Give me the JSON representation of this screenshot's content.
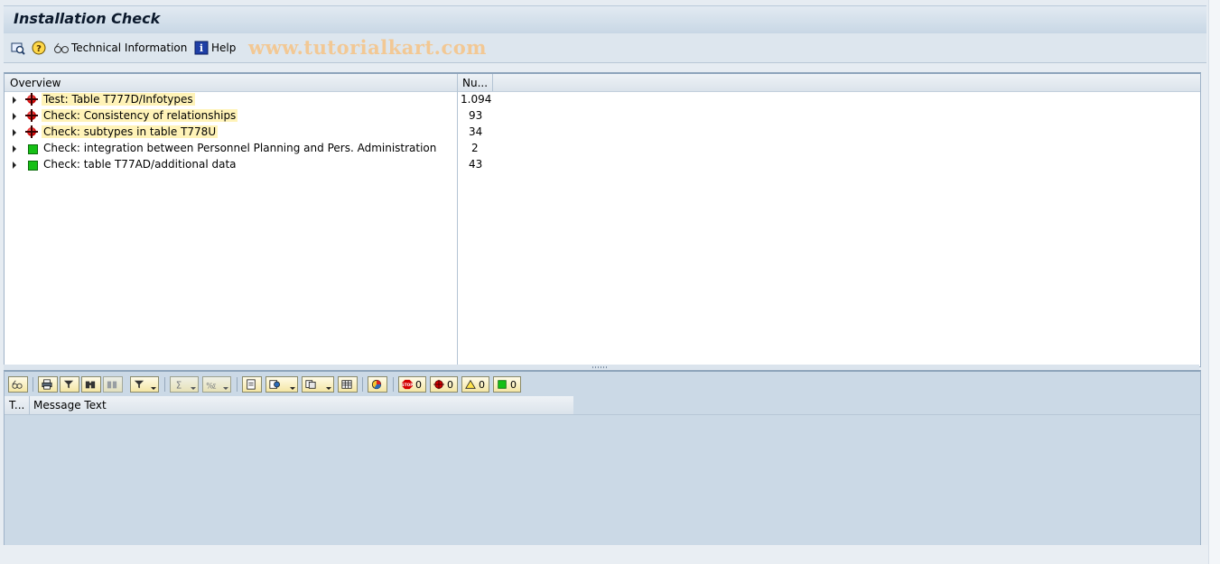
{
  "window": {
    "title": "Installation Check"
  },
  "toolbar": {
    "technical_information": "Technical Information",
    "help": "Help",
    "watermark": "www.tutorialkart.com"
  },
  "tree": {
    "columns": {
      "overview": "Overview",
      "number": "Nu..."
    },
    "rows": [
      {
        "text": "Test: Table T777D/Infotypes",
        "number": "1.094",
        "status": "red"
      },
      {
        "text": "Check: Consistency of relationships",
        "number": "93",
        "status": "red"
      },
      {
        "text": "Check: subtypes in table T778U",
        "number": "34",
        "status": "red"
      },
      {
        "text": "Check: integration between Personnel Planning and Pers. Administration",
        "number": "2",
        "status": "green"
      },
      {
        "text": "Check: table T77AD/additional data",
        "number": "43",
        "status": "green"
      }
    ]
  },
  "messages": {
    "counts": {
      "stop": "0",
      "error": "0",
      "warning": "0",
      "ok": "0"
    },
    "columns": {
      "type": "T...",
      "message_text": "Message Text"
    }
  },
  "colors": {
    "error": "#d40000",
    "success": "#16c016",
    "highlight": "#fff3b8",
    "panel": "#cbd9e6"
  }
}
